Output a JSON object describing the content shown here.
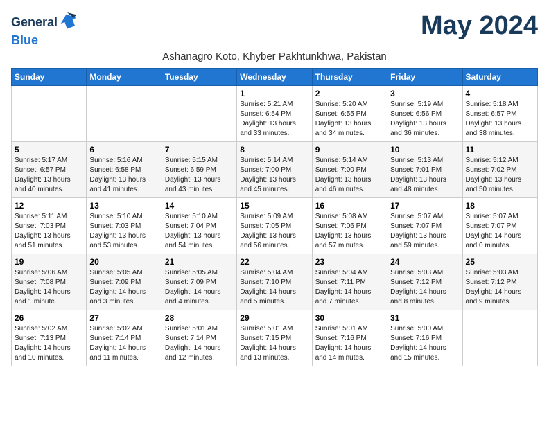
{
  "logo": {
    "general": "General",
    "blue": "Blue",
    "bird_symbol": "▶"
  },
  "title": "May 2024",
  "location": "Ashanagro Koto, Khyber Pakhtunkhwa, Pakistan",
  "days_of_week": [
    "Sunday",
    "Monday",
    "Tuesday",
    "Wednesday",
    "Thursday",
    "Friday",
    "Saturday"
  ],
  "weeks": [
    [
      {
        "day": "",
        "sunrise": "",
        "sunset": "",
        "daylight": ""
      },
      {
        "day": "",
        "sunrise": "",
        "sunset": "",
        "daylight": ""
      },
      {
        "day": "",
        "sunrise": "",
        "sunset": "",
        "daylight": ""
      },
      {
        "day": "1",
        "sunrise": "Sunrise: 5:21 AM",
        "sunset": "Sunset: 6:54 PM",
        "daylight": "Daylight: 13 hours and 33 minutes."
      },
      {
        "day": "2",
        "sunrise": "Sunrise: 5:20 AM",
        "sunset": "Sunset: 6:55 PM",
        "daylight": "Daylight: 13 hours and 34 minutes."
      },
      {
        "day": "3",
        "sunrise": "Sunrise: 5:19 AM",
        "sunset": "Sunset: 6:56 PM",
        "daylight": "Daylight: 13 hours and 36 minutes."
      },
      {
        "day": "4",
        "sunrise": "Sunrise: 5:18 AM",
        "sunset": "Sunset: 6:57 PM",
        "daylight": "Daylight: 13 hours and 38 minutes."
      }
    ],
    [
      {
        "day": "5",
        "sunrise": "Sunrise: 5:17 AM",
        "sunset": "Sunset: 6:57 PM",
        "daylight": "Daylight: 13 hours and 40 minutes."
      },
      {
        "day": "6",
        "sunrise": "Sunrise: 5:16 AM",
        "sunset": "Sunset: 6:58 PM",
        "daylight": "Daylight: 13 hours and 41 minutes."
      },
      {
        "day": "7",
        "sunrise": "Sunrise: 5:15 AM",
        "sunset": "Sunset: 6:59 PM",
        "daylight": "Daylight: 13 hours and 43 minutes."
      },
      {
        "day": "8",
        "sunrise": "Sunrise: 5:14 AM",
        "sunset": "Sunset: 7:00 PM",
        "daylight": "Daylight: 13 hours and 45 minutes."
      },
      {
        "day": "9",
        "sunrise": "Sunrise: 5:14 AM",
        "sunset": "Sunset: 7:00 PM",
        "daylight": "Daylight: 13 hours and 46 minutes."
      },
      {
        "day": "10",
        "sunrise": "Sunrise: 5:13 AM",
        "sunset": "Sunset: 7:01 PM",
        "daylight": "Daylight: 13 hours and 48 minutes."
      },
      {
        "day": "11",
        "sunrise": "Sunrise: 5:12 AM",
        "sunset": "Sunset: 7:02 PM",
        "daylight": "Daylight: 13 hours and 50 minutes."
      }
    ],
    [
      {
        "day": "12",
        "sunrise": "Sunrise: 5:11 AM",
        "sunset": "Sunset: 7:03 PM",
        "daylight": "Daylight: 13 hours and 51 minutes."
      },
      {
        "day": "13",
        "sunrise": "Sunrise: 5:10 AM",
        "sunset": "Sunset: 7:03 PM",
        "daylight": "Daylight: 13 hours and 53 minutes."
      },
      {
        "day": "14",
        "sunrise": "Sunrise: 5:10 AM",
        "sunset": "Sunset: 7:04 PM",
        "daylight": "Daylight: 13 hours and 54 minutes."
      },
      {
        "day": "15",
        "sunrise": "Sunrise: 5:09 AM",
        "sunset": "Sunset: 7:05 PM",
        "daylight": "Daylight: 13 hours and 56 minutes."
      },
      {
        "day": "16",
        "sunrise": "Sunrise: 5:08 AM",
        "sunset": "Sunset: 7:06 PM",
        "daylight": "Daylight: 13 hours and 57 minutes."
      },
      {
        "day": "17",
        "sunrise": "Sunrise: 5:07 AM",
        "sunset": "Sunset: 7:07 PM",
        "daylight": "Daylight: 13 hours and 59 minutes."
      },
      {
        "day": "18",
        "sunrise": "Sunrise: 5:07 AM",
        "sunset": "Sunset: 7:07 PM",
        "daylight": "Daylight: 14 hours and 0 minutes."
      }
    ],
    [
      {
        "day": "19",
        "sunrise": "Sunrise: 5:06 AM",
        "sunset": "Sunset: 7:08 PM",
        "daylight": "Daylight: 14 hours and 1 minute."
      },
      {
        "day": "20",
        "sunrise": "Sunrise: 5:05 AM",
        "sunset": "Sunset: 7:09 PM",
        "daylight": "Daylight: 14 hours and 3 minutes."
      },
      {
        "day": "21",
        "sunrise": "Sunrise: 5:05 AM",
        "sunset": "Sunset: 7:09 PM",
        "daylight": "Daylight: 14 hours and 4 minutes."
      },
      {
        "day": "22",
        "sunrise": "Sunrise: 5:04 AM",
        "sunset": "Sunset: 7:10 PM",
        "daylight": "Daylight: 14 hours and 5 minutes."
      },
      {
        "day": "23",
        "sunrise": "Sunrise: 5:04 AM",
        "sunset": "Sunset: 7:11 PM",
        "daylight": "Daylight: 14 hours and 7 minutes."
      },
      {
        "day": "24",
        "sunrise": "Sunrise: 5:03 AM",
        "sunset": "Sunset: 7:12 PM",
        "daylight": "Daylight: 14 hours and 8 minutes."
      },
      {
        "day": "25",
        "sunrise": "Sunrise: 5:03 AM",
        "sunset": "Sunset: 7:12 PM",
        "daylight": "Daylight: 14 hours and 9 minutes."
      }
    ],
    [
      {
        "day": "26",
        "sunrise": "Sunrise: 5:02 AM",
        "sunset": "Sunset: 7:13 PM",
        "daylight": "Daylight: 14 hours and 10 minutes."
      },
      {
        "day": "27",
        "sunrise": "Sunrise: 5:02 AM",
        "sunset": "Sunset: 7:14 PM",
        "daylight": "Daylight: 14 hours and 11 minutes."
      },
      {
        "day": "28",
        "sunrise": "Sunrise: 5:01 AM",
        "sunset": "Sunset: 7:14 PM",
        "daylight": "Daylight: 14 hours and 12 minutes."
      },
      {
        "day": "29",
        "sunrise": "Sunrise: 5:01 AM",
        "sunset": "Sunset: 7:15 PM",
        "daylight": "Daylight: 14 hours and 13 minutes."
      },
      {
        "day": "30",
        "sunrise": "Sunrise: 5:01 AM",
        "sunset": "Sunset: 7:16 PM",
        "daylight": "Daylight: 14 hours and 14 minutes."
      },
      {
        "day": "31",
        "sunrise": "Sunrise: 5:00 AM",
        "sunset": "Sunset: 7:16 PM",
        "daylight": "Daylight: 14 hours and 15 minutes."
      },
      {
        "day": "",
        "sunrise": "",
        "sunset": "",
        "daylight": ""
      }
    ]
  ]
}
